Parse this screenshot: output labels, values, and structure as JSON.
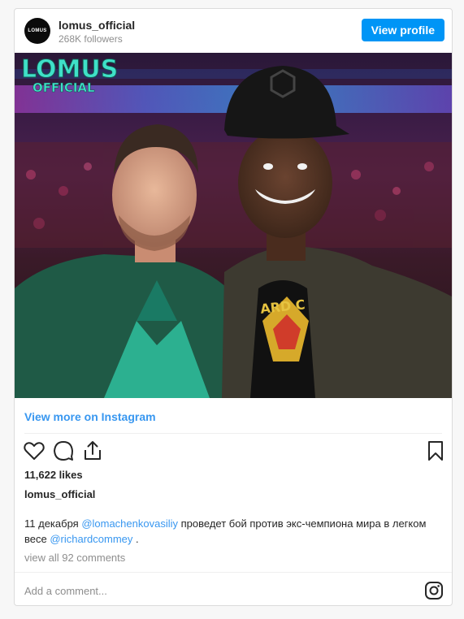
{
  "header": {
    "avatar_text": "LOMUS",
    "username": "lomus_official",
    "followers": "268K followers",
    "view_profile_label": "View profile"
  },
  "photo": {
    "watermark_line1": "LOMUS",
    "watermark_line2": "OFFICIAL",
    "shirt_text": "ARD C"
  },
  "view_more_label": "View more on Instagram",
  "actions": {
    "like_icon": "heart-icon",
    "comment_icon": "comment-icon",
    "share_icon": "share-icon",
    "save_icon": "bookmark-icon"
  },
  "likes": "11,622 likes",
  "owner": "lomus_official",
  "caption": {
    "part1": "11 декабря ",
    "mention1": "@lomachenkovasiliy",
    "part2": " проведет бой против экс-чемпиона мира в легком весе ",
    "mention2": "@richardcommey",
    "part3": " ."
  },
  "comments_link": "view all 92 comments",
  "comment_input": {
    "placeholder": "Add a comment..."
  },
  "colors": {
    "accent": "#0095f6",
    "link": "#3897f0",
    "text": "#262626",
    "muted": "#8e8e8e",
    "watermark": "#3fe0c8"
  }
}
